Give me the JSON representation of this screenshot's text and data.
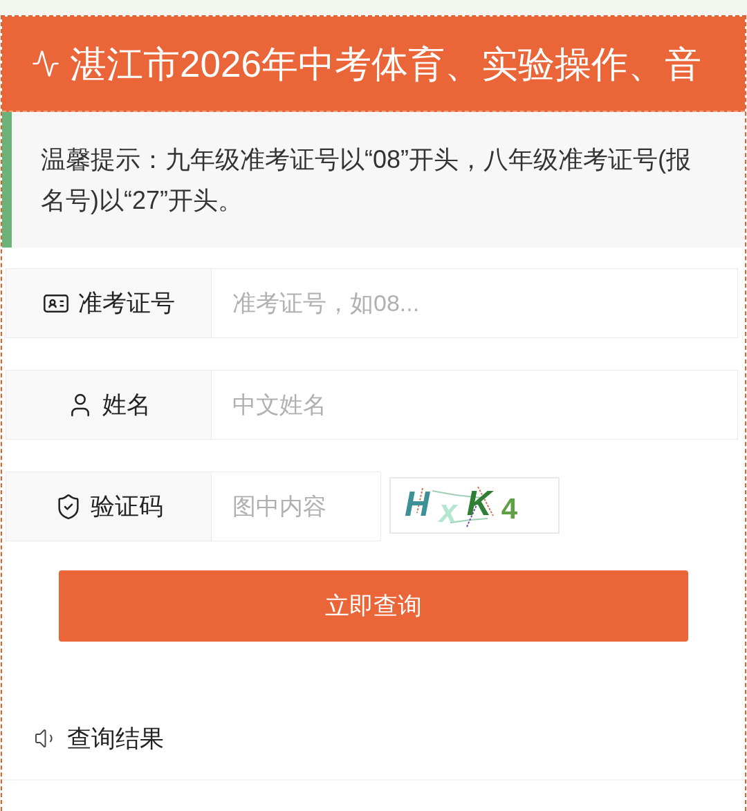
{
  "header": {
    "title": "湛江市2026年中考体育、实验操作、音"
  },
  "notice": {
    "text": "温馨提示：九年级准考证号以“08”开头，八年级准考证号(报名号)以“27”开头。"
  },
  "form": {
    "fields": [
      {
        "kind": "id",
        "label": "准考证号",
        "placeholder": "准考证号，如08..."
      },
      {
        "kind": "name",
        "label": "姓名",
        "placeholder": "中文姓名"
      },
      {
        "kind": "captcha",
        "label": "验证码",
        "placeholder": "图中内容",
        "captcha": [
          "H",
          "x",
          "K",
          "4"
        ]
      }
    ]
  },
  "submit": {
    "label": "立即查询"
  },
  "results": {
    "title": "查询结果"
  }
}
